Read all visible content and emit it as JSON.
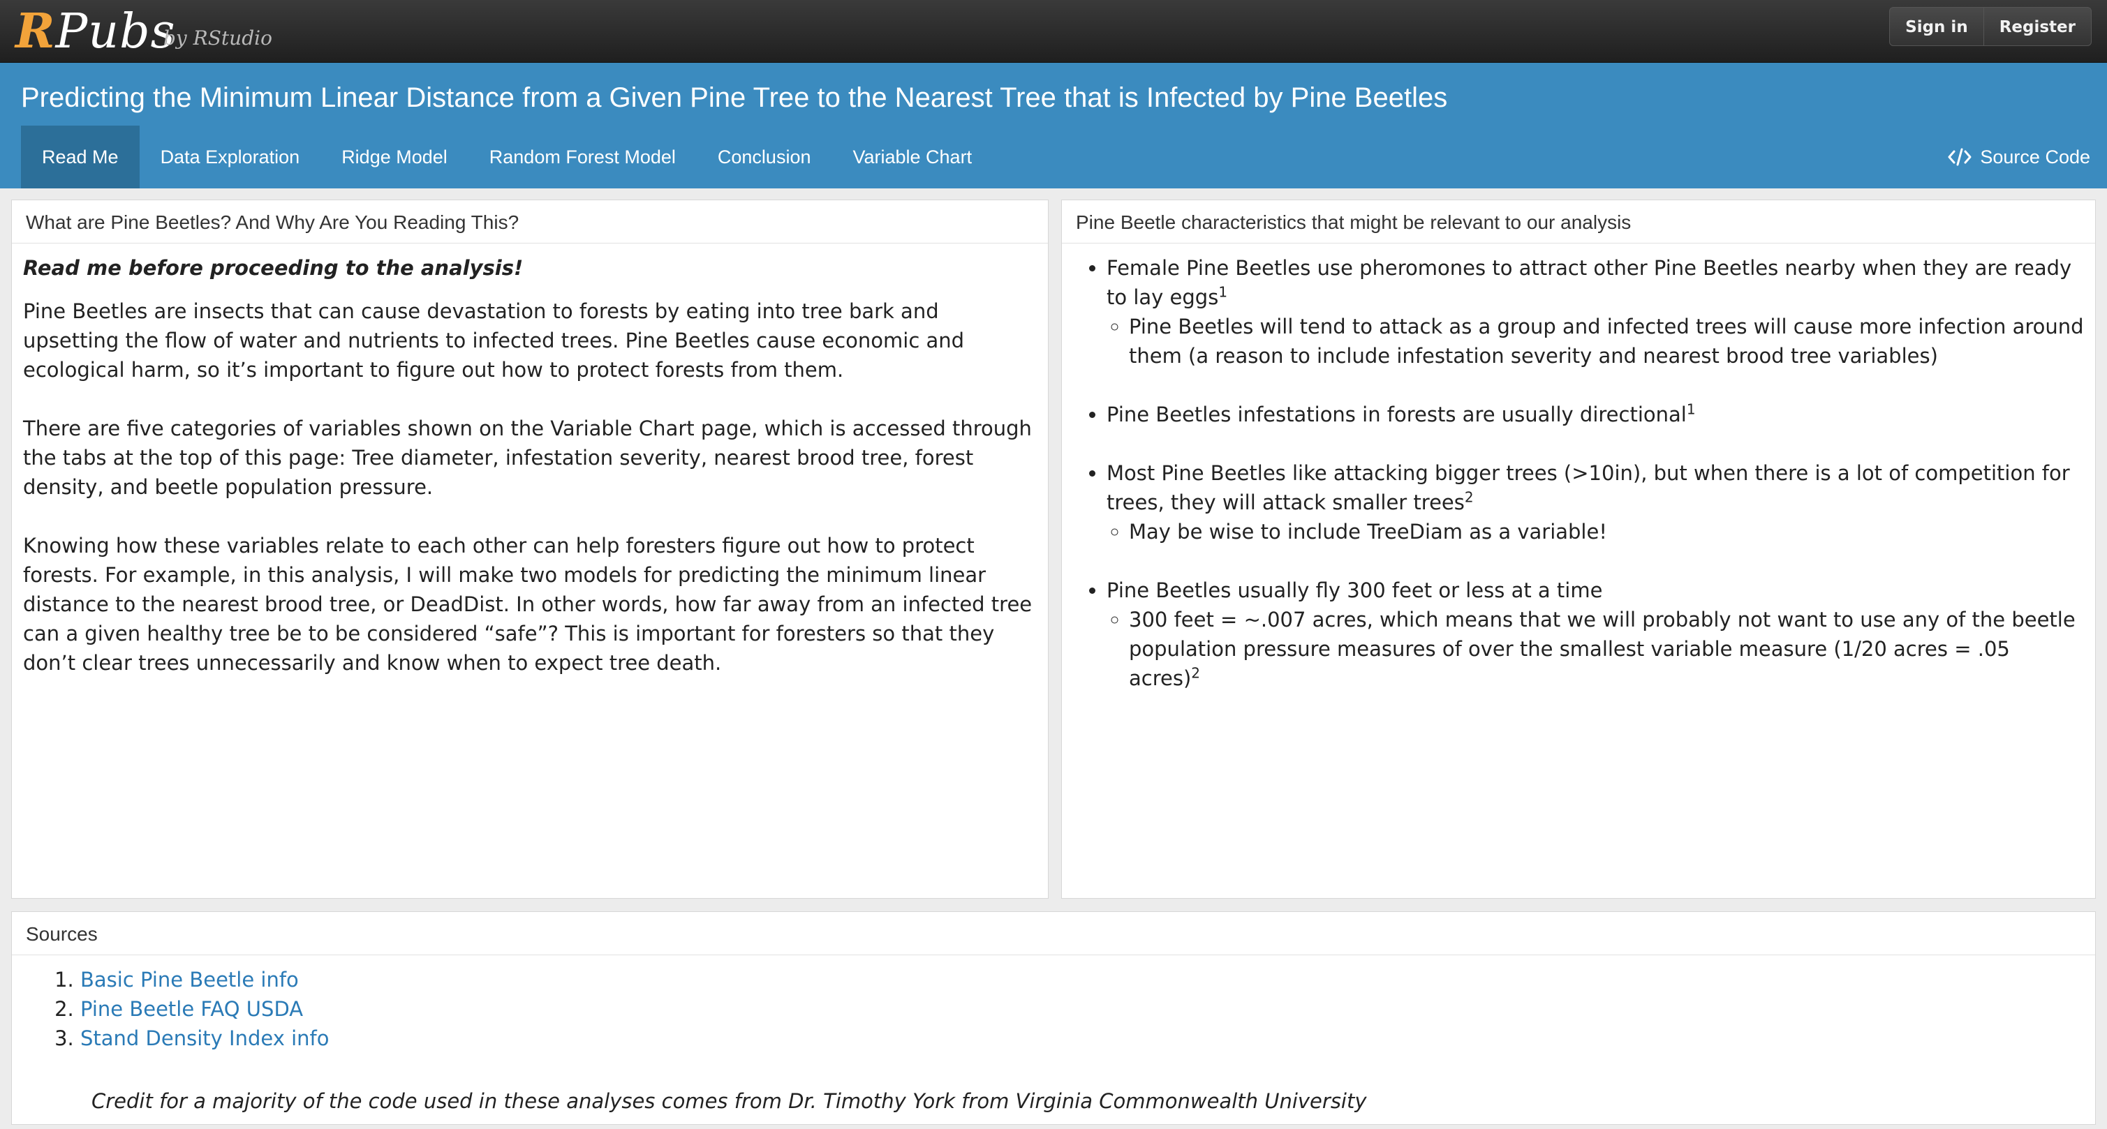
{
  "rpubs": {
    "logo_r": "R",
    "logo_rest": "Pubs",
    "by": "by RStudio",
    "sign_in": "Sign in",
    "register": "Register"
  },
  "dashboard": {
    "title": "Predicting the Minimum Linear Distance from a Given Pine Tree to the Nearest Tree that is Infected by Pine Beetles",
    "tabs": [
      {
        "label": "Read Me",
        "active": true
      },
      {
        "label": "Data Exploration",
        "active": false
      },
      {
        "label": "Ridge Model",
        "active": false
      },
      {
        "label": "Random Forest Model",
        "active": false
      },
      {
        "label": "Conclusion",
        "active": false
      },
      {
        "label": "Variable Chart",
        "active": false
      }
    ],
    "source_code": "Source Code",
    "source_code_icon": "code-icon"
  },
  "left_panel": {
    "title": "What are Pine Beetles? And Why Are You Reading This?",
    "lead": "Read me before proceeding to the analysis!",
    "paragraphs": [
      "Pine Beetles are insects that can cause devastation to forests by eating into tree bark and upsetting the flow of water and nutrients to infected trees. Pine Beetles cause economic and ecological harm, so it’s important to figure out how to protect forests from them.",
      "There are five categories of variables shown on the Variable Chart page, which is accessed through the tabs at the top of this page: Tree diameter, infestation severity, nearest brood tree, forest density, and beetle population pressure.",
      "Knowing how these variables relate to each other can help foresters figure out how to protect forests. For example, in this analysis, I will make two models for predicting the minimum linear distance to the nearest brood tree, or DeadDist. In other words, how far away from an infected tree can a given healthy tree be to be considered “safe”? This is important for foresters so that they don’t clear trees unnecessarily and know when to expect tree death."
    ]
  },
  "right_panel": {
    "title": "Pine Beetle characteristics that might be relevant to our analysis",
    "items": [
      {
        "text": "Female Pine Beetles use pheromones to attract other Pine Beetles nearby when they are ready to lay eggs",
        "sup": "1",
        "sub": [
          "Pine Beetles will tend to attack as a group and infected trees will cause more infection around them (a reason to include infestation severity and nearest brood tree variables)"
        ]
      },
      {
        "text": "Pine Beetles infestations in forests are usually directional",
        "sup": "1",
        "sub": []
      },
      {
        "text": "Most Pine Beetles like attacking bigger trees (>10in), but when there is a lot of competition for trees, they will attack smaller trees",
        "sup": "2",
        "sub": [
          "May be wise to include TreeDiam as a variable!"
        ]
      },
      {
        "text": "Pine Beetles usually fly 300 feet or less at a time",
        "sup": "",
        "sub": [
          "300 feet = ~.007 acres, which means that we will probably not want to use any of the beetle population pressure measures of over the smallest variable measure (1/20 acres = .05 acres)"
        ],
        "sub_sup": "2"
      }
    ]
  },
  "sources_panel": {
    "title": "Sources",
    "links": [
      "Basic Pine Beetle info",
      "Pine Beetle FAQ USDA",
      "Stand Density Index info"
    ],
    "credit": "Credit for a majority of the code used in these analyses comes from Dr. Timothy York from Virginia Commonwealth University"
  }
}
